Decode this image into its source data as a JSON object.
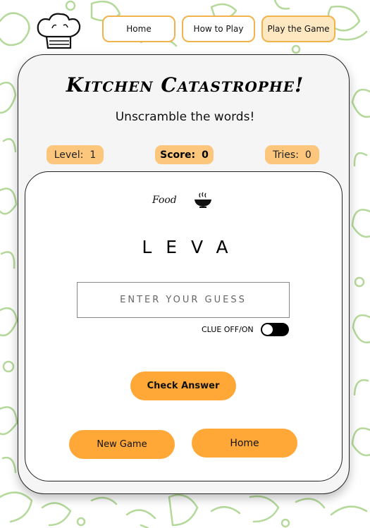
{
  "nav": {
    "home": "Home",
    "how_to_play": "How to Play",
    "play_game": "Play the Game"
  },
  "header": {
    "title": "Kitchen Catastrophe!",
    "subtitle": "Unscramble the words!"
  },
  "stats": {
    "level_label": "Level:",
    "level_value": "1",
    "score_label": "Score:",
    "score_value": "0",
    "tries_label": "Tries:",
    "tries_value": "0"
  },
  "game": {
    "category": "Food",
    "category_icon": "bowl-icon",
    "scrambled_word": "LEVA",
    "guess_placeholder": "ENTER YOUR GUESS",
    "guess_value": "",
    "clue_label": "CLUE OFF/ON",
    "clue_enabled": false,
    "check_label": "Check Answer",
    "new_game_label": "New Game",
    "home_label": "Home"
  },
  "colors": {
    "accent": "#ffa838",
    "pill": "#fcc77d",
    "nav_border": "#f2b24c",
    "nav_active_bg": "#fde8c2",
    "doodle": "#a8d48c"
  }
}
